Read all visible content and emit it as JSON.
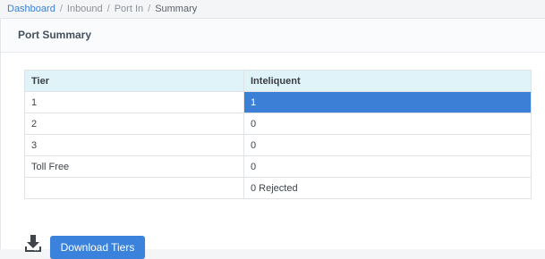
{
  "breadcrumb": {
    "items": [
      "Dashboard",
      "Inbound",
      "Port In",
      "Summary"
    ],
    "separator": "/"
  },
  "card": {
    "title": "Port Summary"
  },
  "table": {
    "headers": [
      "Tier",
      "Inteliquent"
    ],
    "rows": [
      [
        "1",
        "1"
      ],
      [
        "2",
        "0"
      ],
      [
        "3",
        "0"
      ],
      [
        "Toll Free",
        "0"
      ],
      [
        "",
        "0 Rejected"
      ]
    ],
    "highlight_color": "#3b7fd6",
    "header_bg": "#dff3f8"
  },
  "actions": {
    "download_icon": "download-icon",
    "download_label": "Download Tiers",
    "button_color": "#3b82dc"
  }
}
